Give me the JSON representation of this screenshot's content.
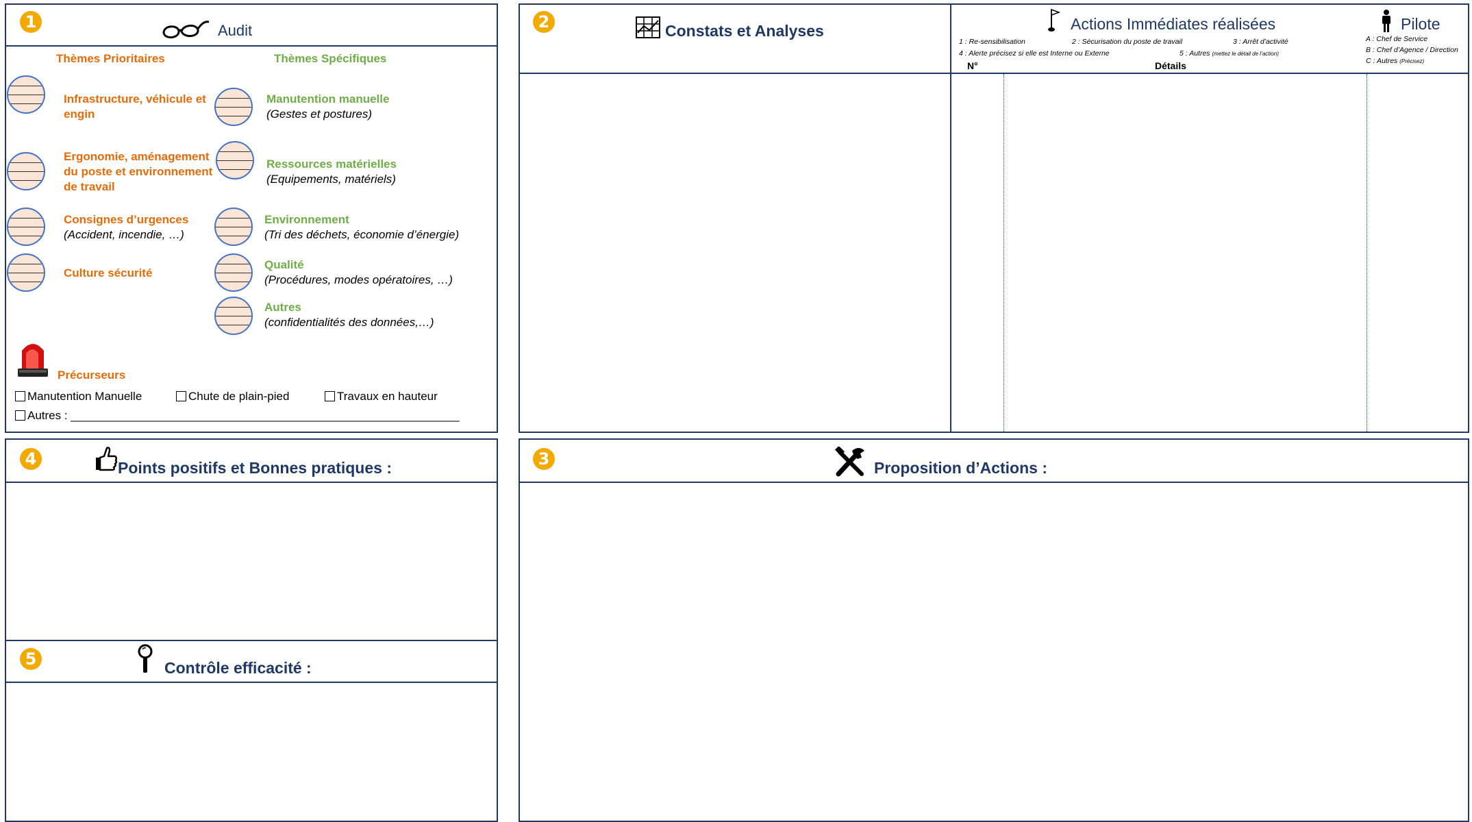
{
  "panel1": {
    "badge": "❶",
    "title": "Audit",
    "priority_header": "Thèmes Prioritaires",
    "specific_header": "Thèmes Spécifiques",
    "priority_themes": [
      {
        "title": "Infrastructure, véhicule et engin",
        "subtitle": ""
      },
      {
        "title": "Ergonomie, aménagement du poste et environnement de travail",
        "subtitle": ""
      },
      {
        "title": "Consignes d’urgences",
        "subtitle": "(Accident, incendie, …)"
      },
      {
        "title": "Culture sécurité",
        "subtitle": ""
      }
    ],
    "specific_themes": [
      {
        "title": "Manutention manuelle",
        "subtitle": "(Gestes et postures)"
      },
      {
        "title": "Ressources matérielles",
        "subtitle": "(Equipements, matériels)"
      },
      {
        "title": "Environnement",
        "subtitle": "(Tri des déchets, économie d’énergie)"
      },
      {
        "title": "Qualité",
        "subtitle": "(Procédures, modes opératoires, …)"
      },
      {
        "title": "Autres",
        "subtitle": "(confidentialités des données,…)"
      }
    ],
    "precursors_title": "Précurseurs",
    "precursors": [
      "Manutention Manuelle",
      "Chute de plain-pied",
      "Travaux en hauteur"
    ],
    "other_label": "Autres : ____________________________________________________________"
  },
  "panel2": {
    "badge": "❷",
    "title": "Constats et Analyses",
    "actions_title": "Actions Immédiates réalisées",
    "actions_legend": [
      "1 : Re-sensibilisation",
      "2 : Sécurisation du poste de travail",
      "3 : Arrêt d’activité",
      "4 : Alerte précisez si elle est Interne ou Externe",
      "5 : Autres"
    ],
    "actions_legend_note": "(mettez le détail de l’action)",
    "col_no": "N°",
    "col_details": "Détails",
    "pilote_title": "Pilote",
    "pilote_legend": [
      "A : Chef de Service",
      "B : Chef d’Agence / Direction",
      "C : Autres"
    ],
    "pilote_note": "(Précisez)"
  },
  "panel3": {
    "badge": "❸",
    "title": "Proposition d’Actions :"
  },
  "panel4": {
    "badge": "❹",
    "title": "Points positifs et  Bonnes pratiques :"
  },
  "panel5": {
    "badge": "❺",
    "title": "Contrôle efficacité :"
  },
  "colors": {
    "border": "#1f3864",
    "badge": "#f2a900",
    "priority": "#e46c0a",
    "specific": "#70ad47",
    "circle_fill": "#fbe5d6",
    "circle_stroke": "#4472c4"
  }
}
